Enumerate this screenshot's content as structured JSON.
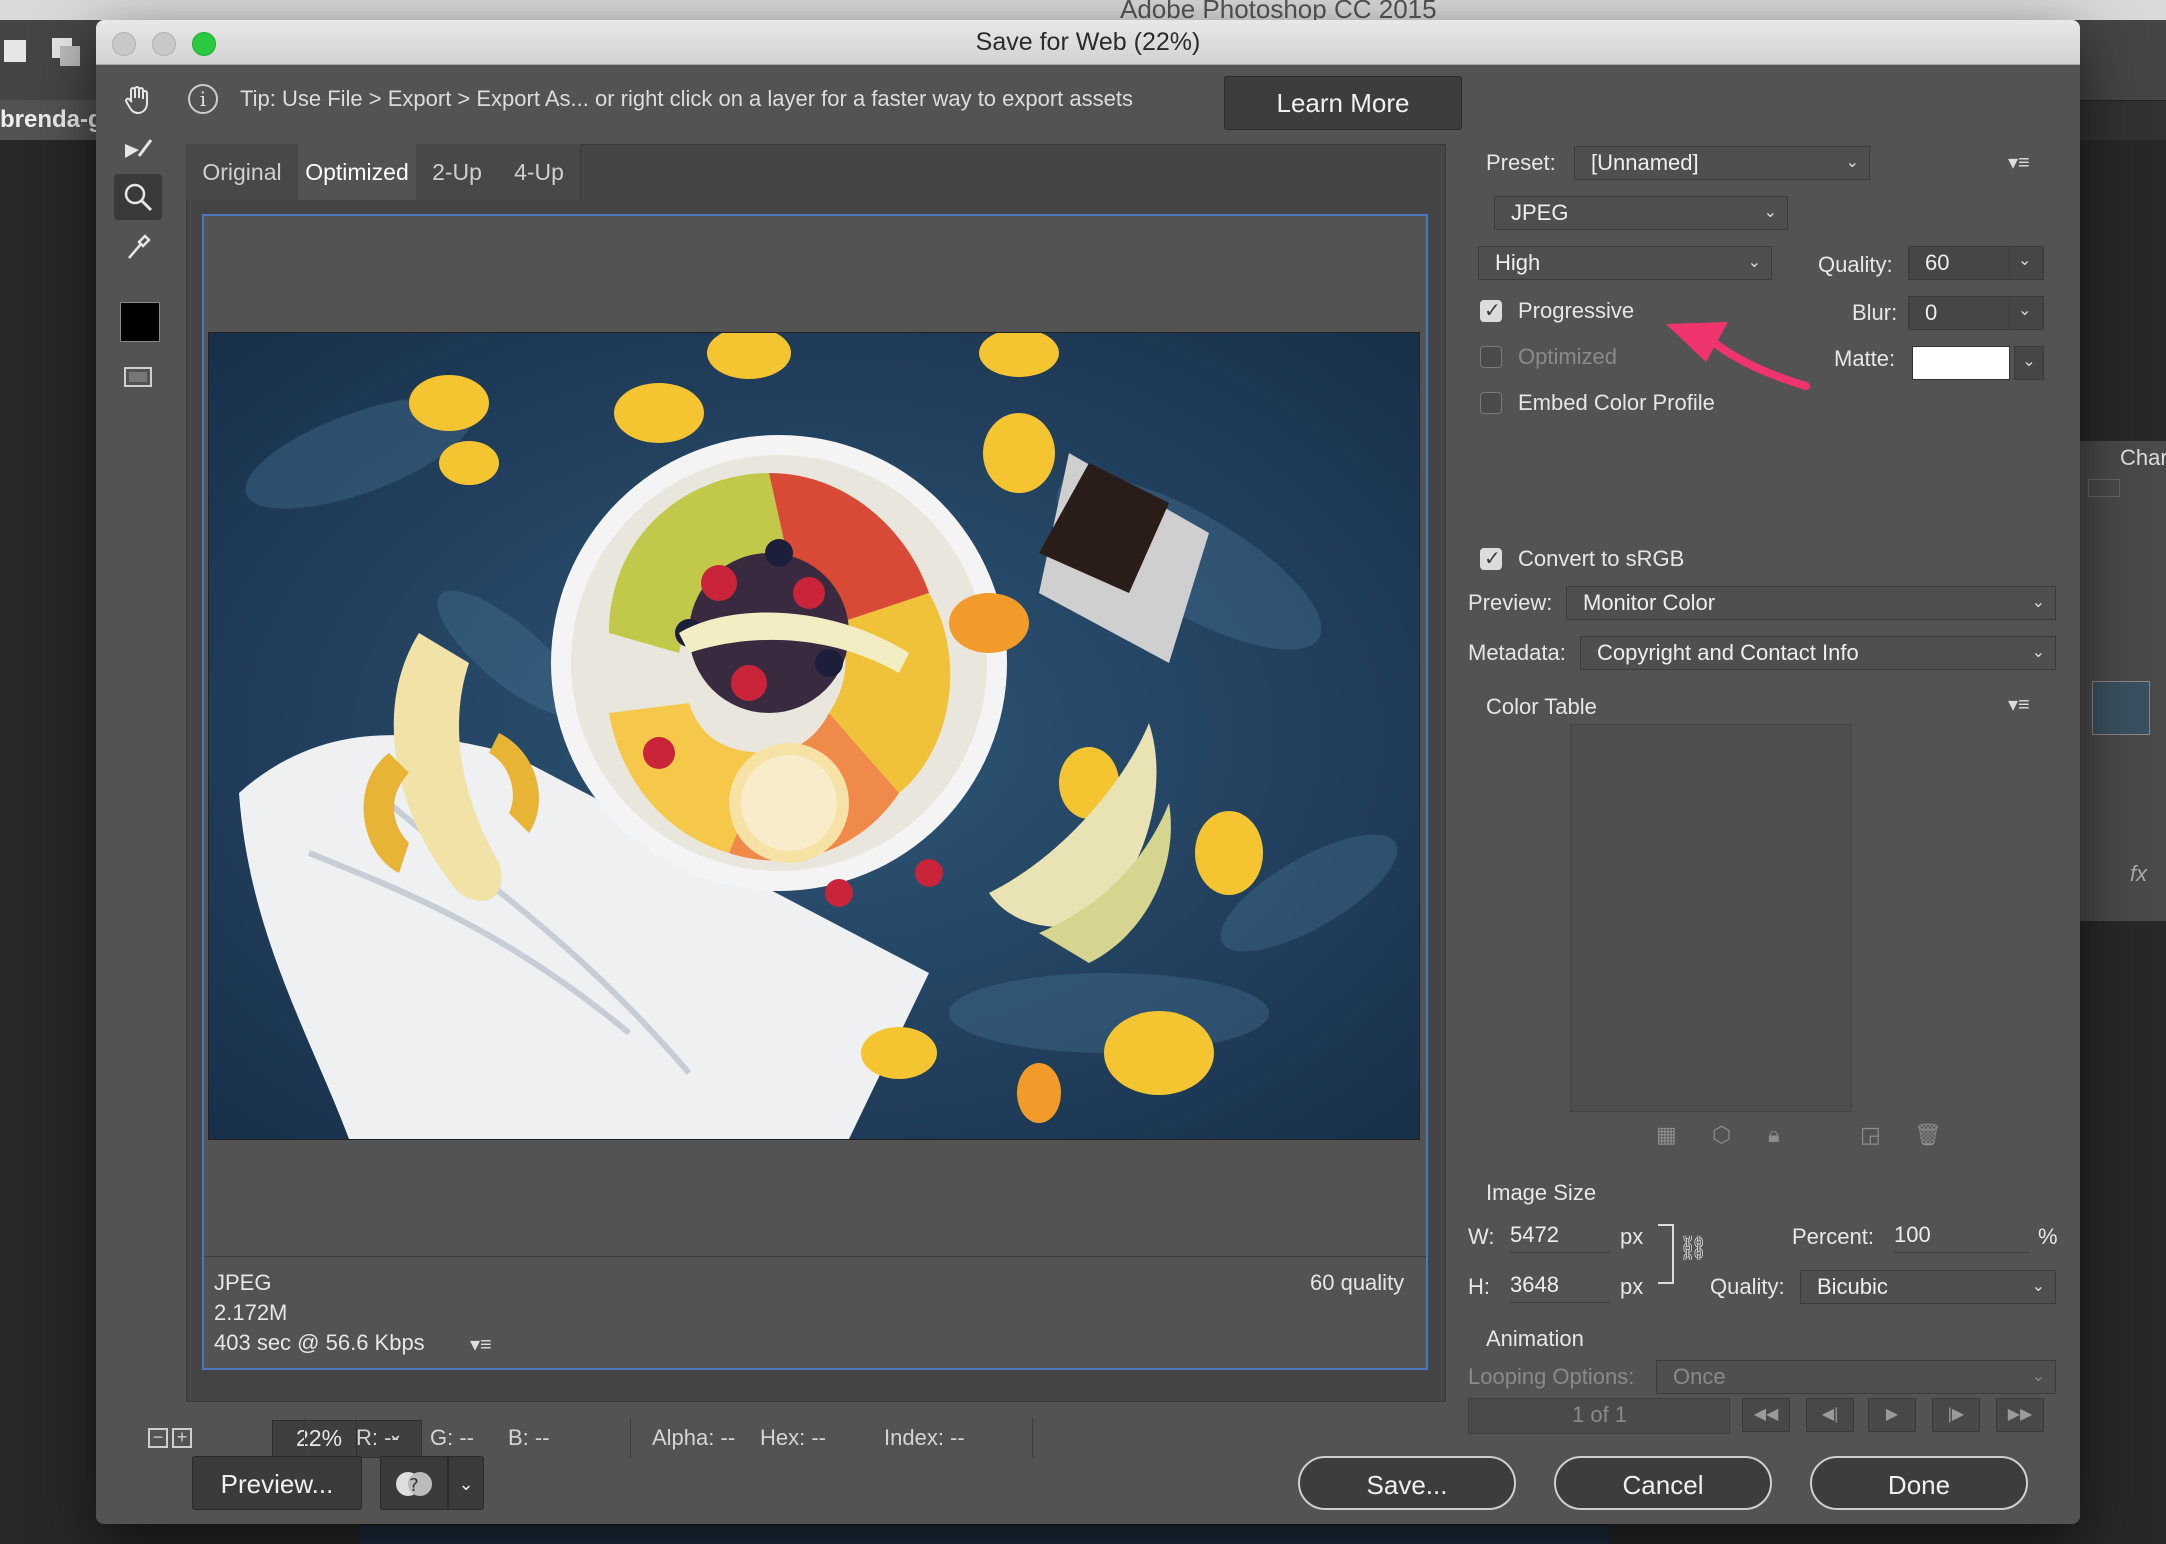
{
  "app": {
    "title": "Adobe Photoshop CC 2015",
    "doc_tab": "brenda-go"
  },
  "dialog": {
    "title": "Save for Web (22%)"
  },
  "tip": {
    "text": "Tip: Use File > Export > Export As...  or right click on a layer for a faster way to export assets",
    "learn_more": "Learn More"
  },
  "tools": [
    "hand-tool",
    "slice-select-tool",
    "zoom-tool",
    "eyedropper-tool"
  ],
  "view_tabs": [
    "Original",
    "Optimized",
    "2-Up",
    "4-Up"
  ],
  "active_view_tab": "Optimized",
  "preview_info": {
    "format": "JPEG",
    "size": "2.172M",
    "time": "403 sec @ 56.6 Kbps",
    "quality": "60 quality"
  },
  "status": {
    "zoom": "22%",
    "r": "R: --",
    "g": "G: --",
    "b": "B: --",
    "alpha": "Alpha: --",
    "hex": "Hex: --",
    "index": "Index: --"
  },
  "buttons": {
    "preview": "Preview...",
    "save": "Save...",
    "cancel": "Cancel",
    "done": "Done"
  },
  "settings": {
    "preset_label": "Preset:",
    "preset_value": "[Unnamed]",
    "format": "JPEG",
    "quality_level": "High",
    "quality_label": "Quality:",
    "quality_value": "60",
    "blur_label": "Blur:",
    "blur_value": "0",
    "matte_label": "Matte:",
    "matte_color": "#ffffff",
    "progressive": {
      "label": "Progressive",
      "checked": true
    },
    "optimized": {
      "label": "Optimized",
      "checked": false
    },
    "embed_profile": {
      "label": "Embed Color Profile",
      "checked": false
    },
    "convert_srgb": {
      "label": "Convert to sRGB",
      "checked": true
    },
    "preview_label": "Preview:",
    "preview_value": "Monitor Color",
    "metadata_label": "Metadata:",
    "metadata_value": "Copyright and Contact Info",
    "color_table_label": "Color Table"
  },
  "image_size": {
    "heading": "Image Size",
    "w_label": "W:",
    "w_value": "5472",
    "h_label": "H:",
    "h_value": "3648",
    "unit": "px",
    "percent_label": "Percent:",
    "percent_value": "100",
    "percent_unit": "%",
    "quality_label": "Quality:",
    "quality_value": "Bicubic"
  },
  "animation": {
    "heading": "Animation",
    "looping_label": "Looping Options:",
    "looping_value": "Once",
    "frame": "1 of 1"
  },
  "right_panel": {
    "tab": "Char"
  },
  "colors": {
    "accent_arrow": "#f0346e",
    "selection_border": "#4a78b8"
  }
}
